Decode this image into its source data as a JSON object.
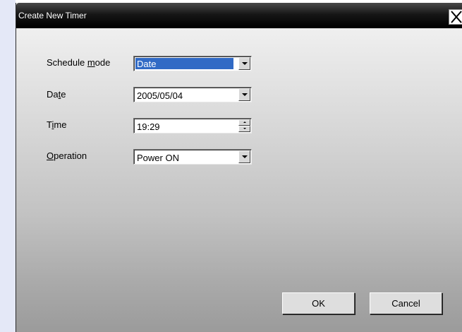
{
  "window": {
    "title": "Create New Timer",
    "close_glyph": "✕"
  },
  "form": {
    "schedule_mode": {
      "label_pre": "Schedule ",
      "label_key": "m",
      "label_post": "ode",
      "value": "Date"
    },
    "date": {
      "label_pre": "Da",
      "label_key": "t",
      "label_post": "e",
      "value": "2005/05/04"
    },
    "time": {
      "label_pre": "T",
      "label_key": "i",
      "label_post": "me",
      "value": "19:29"
    },
    "operation": {
      "label_pre": "",
      "label_key": "O",
      "label_post": "peration",
      "value": "Power ON"
    }
  },
  "buttons": {
    "ok": "OK",
    "cancel": "Cancel"
  },
  "colors": {
    "selection": "#316ac5",
    "titlebar": "#000000",
    "left_margin": "#e4e8f7"
  },
  "icons": {
    "close": "close-icon",
    "dropdown": "chevron-down-icon",
    "spin_up": "spin-up-icon",
    "spin_down": "spin-down-icon"
  }
}
